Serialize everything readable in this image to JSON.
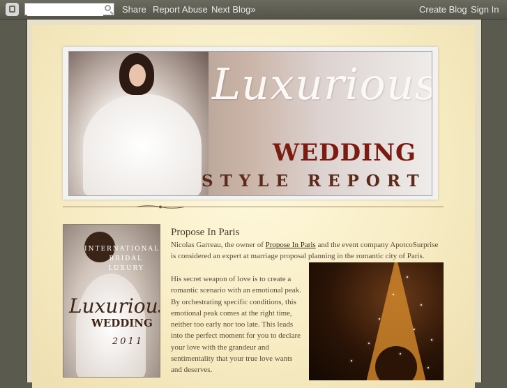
{
  "navbar": {
    "search_placeholder": "",
    "share": "Share",
    "report_abuse": "Report Abuse",
    "next_blog": "Next Blog»",
    "create_blog": "Create Blog",
    "sign_in": "Sign In"
  },
  "header": {
    "title_script": "Luxurious",
    "title_main": "WEDDING",
    "subtitle": "STYLE REPORT"
  },
  "sidebar": {
    "line1": "INTERNATIONAL",
    "line2": "BRIDAL",
    "line3": "LUXURY",
    "script": "Luxurious",
    "word": "WEDDING",
    "year": "2011"
  },
  "post": {
    "title": "Propose In Paris",
    "p1_before": "Nicolas Garreau, the owner of ",
    "p1_link": "Propose In Paris",
    "p1_after": " and the event company ApotcoSurprise is considered an expert at marriage proposal planning in the romantic city of Paris.",
    "p2": "His secret weapon of love is to create a romantic scenario with an emotional peak. By orchestrating specific conditions, this emotional peak comes at the right time, neither too early nor too late. This leads into the perfect moment for you to declare your love with the grandeur and sentimentality that your true love wants and deserves."
  },
  "colors": {
    "navbar": "#5e5d52",
    "paper": "#f7ecc4",
    "wedding_red": "#7a1c12",
    "text": "#5a4838"
  },
  "icons": {
    "blogger_logo": "blogger-logo-icon",
    "search": "search-icon"
  }
}
